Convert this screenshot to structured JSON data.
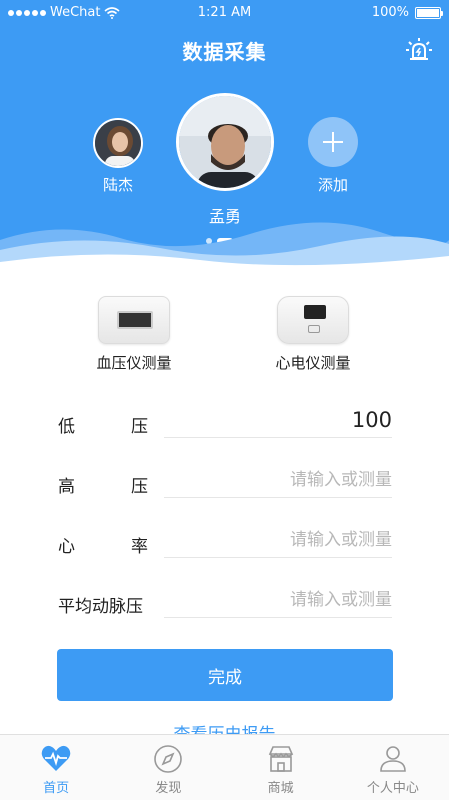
{
  "status_bar": {
    "carrier": "WeChat",
    "time": "1:21 AM",
    "battery": "100%"
  },
  "header": {
    "title": "数据采集"
  },
  "profiles": {
    "left_name": "陆杰",
    "center_name": "孟勇",
    "add_label": "添加"
  },
  "devices": [
    {
      "label": "血压仪测量"
    },
    {
      "label": "心电仪测量"
    }
  ],
  "form": {
    "low": {
      "label_a": "低",
      "label_b": "压",
      "value": "100",
      "placeholder": "请输入或测量"
    },
    "high": {
      "label_a": "高",
      "label_b": "压",
      "value": "",
      "placeholder": "请输入或测量"
    },
    "rate": {
      "label_a": "心",
      "label_b": "率",
      "value": "",
      "placeholder": "请输入或测量"
    },
    "map": {
      "label": "平均动脉压",
      "value": "",
      "placeholder": "请输入或测量"
    }
  },
  "done_label": "完成",
  "report_link": "查看历史报告",
  "tabs": [
    {
      "label": "首页"
    },
    {
      "label": "发现"
    },
    {
      "label": "商城"
    },
    {
      "label": "个人中心"
    }
  ],
  "colors": {
    "primary": "#3d9bf4",
    "tab_inactive": "#888888"
  }
}
